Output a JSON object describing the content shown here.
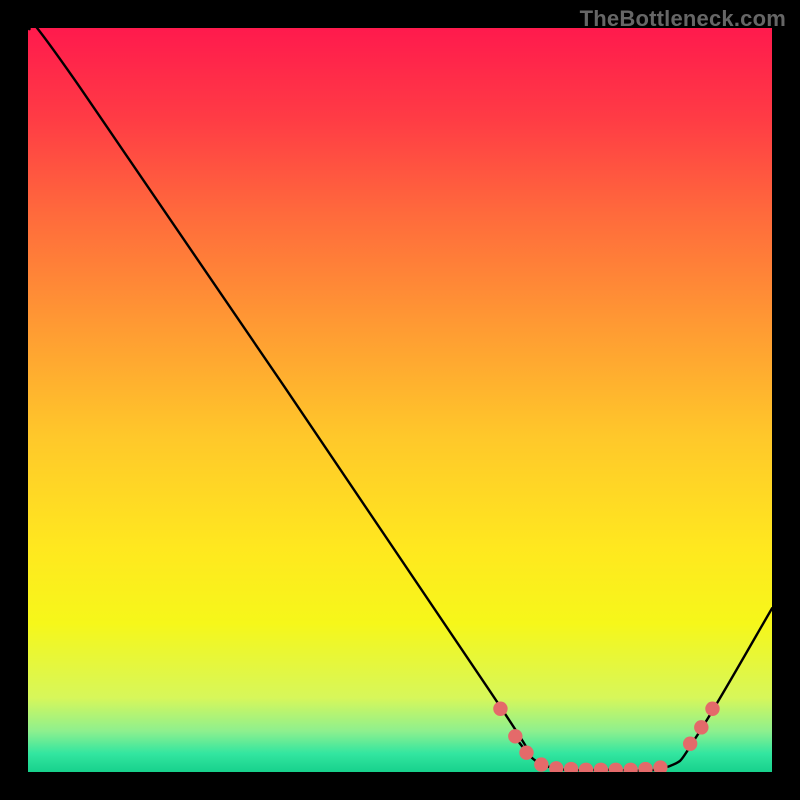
{
  "watermark": "TheBottleneck.com",
  "chart_data": {
    "type": "line",
    "title": "",
    "xlabel": "",
    "ylabel": "",
    "xlim": [
      0,
      100
    ],
    "ylim": [
      0,
      100
    ],
    "curve": {
      "name": "bottleneck-curve",
      "color": "#000000",
      "points": [
        {
          "x": 0,
          "y": 100
        },
        {
          "x": 7,
          "y": 92
        },
        {
          "x": 62,
          "y": 11
        },
        {
          "x": 66,
          "y": 4
        },
        {
          "x": 70,
          "y": 0.7
        },
        {
          "x": 78,
          "y": 0.3
        },
        {
          "x": 86,
          "y": 0.7
        },
        {
          "x": 90,
          "y": 5
        },
        {
          "x": 100,
          "y": 22
        }
      ]
    },
    "markers": {
      "name": "highlighted-points",
      "color": "#e46a6a",
      "points": [
        {
          "x": 63.5,
          "y": 8.5
        },
        {
          "x": 65.5,
          "y": 4.8
        },
        {
          "x": 67,
          "y": 2.6
        },
        {
          "x": 69,
          "y": 1.0
        },
        {
          "x": 71,
          "y": 0.5
        },
        {
          "x": 73,
          "y": 0.4
        },
        {
          "x": 75,
          "y": 0.3
        },
        {
          "x": 77,
          "y": 0.3
        },
        {
          "x": 79,
          "y": 0.3
        },
        {
          "x": 81,
          "y": 0.3
        },
        {
          "x": 83,
          "y": 0.4
        },
        {
          "x": 85,
          "y": 0.6
        },
        {
          "x": 89,
          "y": 3.8
        },
        {
          "x": 90.5,
          "y": 6.0
        },
        {
          "x": 92,
          "y": 8.5
        }
      ]
    },
    "background_gradient": {
      "type": "vertical",
      "stops": [
        {
          "offset": 0.0,
          "color": "#ff1a4d"
        },
        {
          "offset": 0.12,
          "color": "#ff3b45"
        },
        {
          "offset": 0.25,
          "color": "#ff6a3c"
        },
        {
          "offset": 0.4,
          "color": "#ff9a33"
        },
        {
          "offset": 0.55,
          "color": "#ffc82a"
        },
        {
          "offset": 0.7,
          "color": "#ffe81f"
        },
        {
          "offset": 0.8,
          "color": "#f6f71a"
        },
        {
          "offset": 0.9,
          "color": "#d7f75a"
        },
        {
          "offset": 0.945,
          "color": "#8ef08e"
        },
        {
          "offset": 0.975,
          "color": "#33e6a0"
        },
        {
          "offset": 1.0,
          "color": "#17d18c"
        }
      ]
    }
  }
}
